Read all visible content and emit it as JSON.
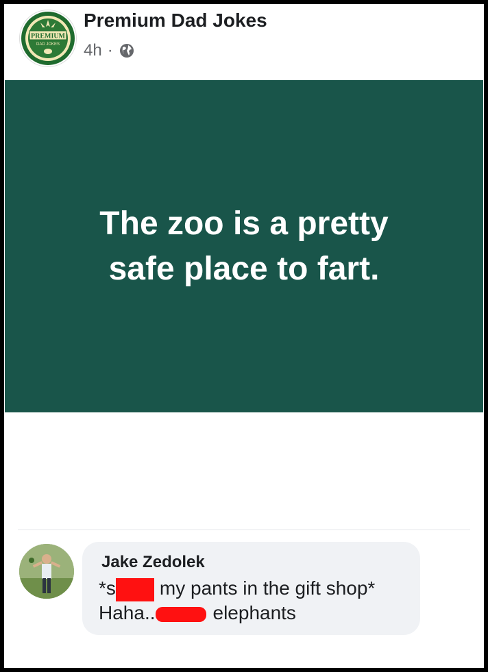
{
  "post": {
    "page_name": "Premium Dad Jokes",
    "timestamp": "4h",
    "separator": "·",
    "privacy_icon": "globe-icon",
    "logo_text": "PREMIUM",
    "logo_subtext": "DAD JOKES",
    "joke_line1": "The zoo is a pretty",
    "joke_line2": "safe place to fart.",
    "card_color": "#19554a"
  },
  "comment": {
    "author": "Jake Zedolek",
    "line1_start": "*s",
    "line1_end": "my pants in the gift shop*",
    "line2_start": "Haha..",
    "line2_end": "elephants",
    "redaction_color": "#ff1111"
  }
}
